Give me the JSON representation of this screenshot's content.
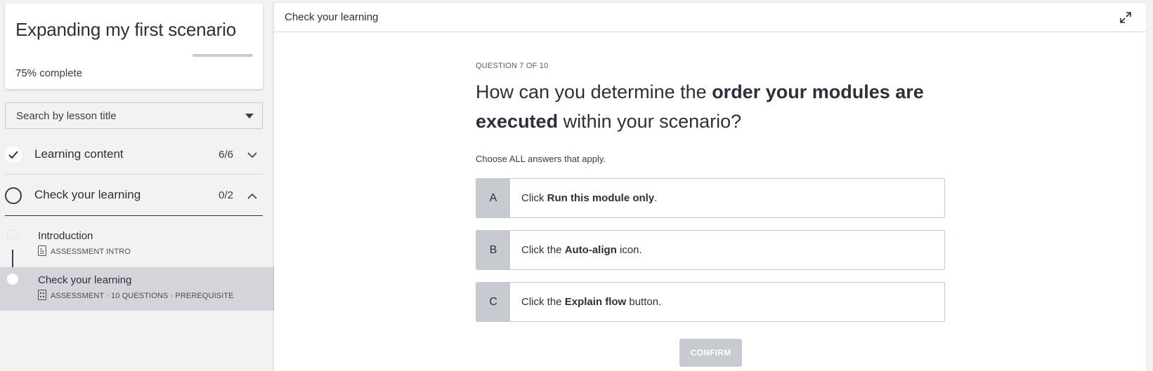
{
  "course": {
    "title": "Expanding my first scenario",
    "progress_percent": "75%",
    "progress_label": "complete",
    "progress_value": 0.75
  },
  "search": {
    "placeholder": "Search by lesson title"
  },
  "sections": [
    {
      "label": "Learning content",
      "count": "6/6",
      "status": "complete",
      "expanded": false
    },
    {
      "label": "Check your learning",
      "count": "0/2",
      "status": "incomplete",
      "expanded": true
    }
  ],
  "lessons": [
    {
      "title": "Introduction",
      "meta": "ASSESSMENT INTRO"
    },
    {
      "title": "Check your learning",
      "meta": "ASSESSMENT · 10 QUESTIONS · PREREQUISITE"
    }
  ],
  "main": {
    "header_title": "Check your learning",
    "question_counter": "QUESTION 7 OF 10",
    "question_parts": {
      "p1": "How can you determine the ",
      "b1": "order your modules are executed",
      "p2": " within your scenario?"
    },
    "instruction": "Choose ALL answers that apply.",
    "answers": [
      {
        "letter": "A",
        "pre": "Click ",
        "bold": "Run this module only",
        "post": "."
      },
      {
        "letter": "B",
        "pre": "Click the ",
        "bold": "Auto-align",
        "post": " icon."
      },
      {
        "letter": "C",
        "pre": "Click the ",
        "bold": "Explain flow",
        "post": " button."
      }
    ],
    "confirm_label": "CONFIRM"
  },
  "icons": {
    "check": "check-icon",
    "chevron_down": "chevron-down-icon",
    "chevron_up": "chevron-up-icon",
    "caret_down": "caret-down-icon",
    "expand": "expand-icon",
    "document": "document-icon"
  },
  "colors": {
    "text": "#2d2f3a",
    "muted": "#c8cad2",
    "selected_row": "#d4d5da",
    "sidebar_bg": "#f2f2f3"
  }
}
